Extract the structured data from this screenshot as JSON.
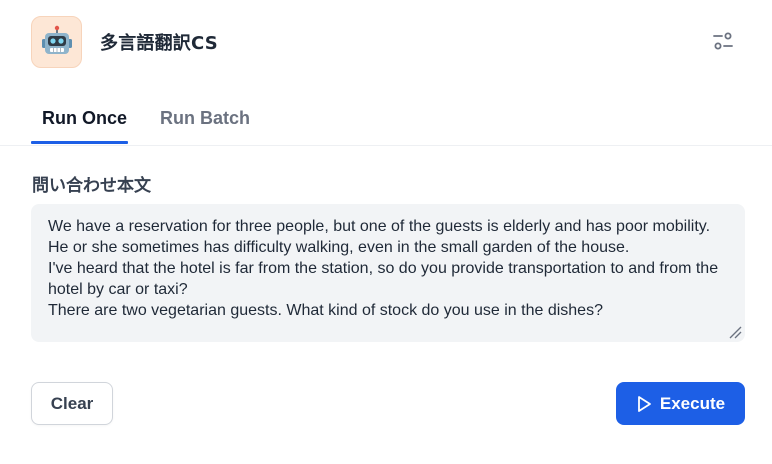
{
  "app": {
    "title": "多言語翻訳CS",
    "icon": "robot-icon",
    "icon_bg": "#fde7d6"
  },
  "header": {
    "settings_icon": "settings-sliders-icon"
  },
  "tabs": [
    {
      "label": "Run Once",
      "active": true
    },
    {
      "label": "Run Batch",
      "active": false
    }
  ],
  "form": {
    "field_label": "問い合わせ本文",
    "field_value": "We have a reservation for three people, but one of the guests is elderly and has poor mobility.\nHe or she sometimes has difficulty walking, even in the small garden of the house.\nI've heard that the hotel is far from the station, so do you provide transportation to and from the hotel by car or taxi?\nThere are two vegetarian guests. What kind of stock do you use in the dishes?"
  },
  "actions": {
    "clear_label": "Clear",
    "execute_label": "Execute",
    "execute_icon": "play-icon"
  },
  "colors": {
    "accent": "#1d5fe6",
    "textarea_bg": "#f2f4f6"
  }
}
